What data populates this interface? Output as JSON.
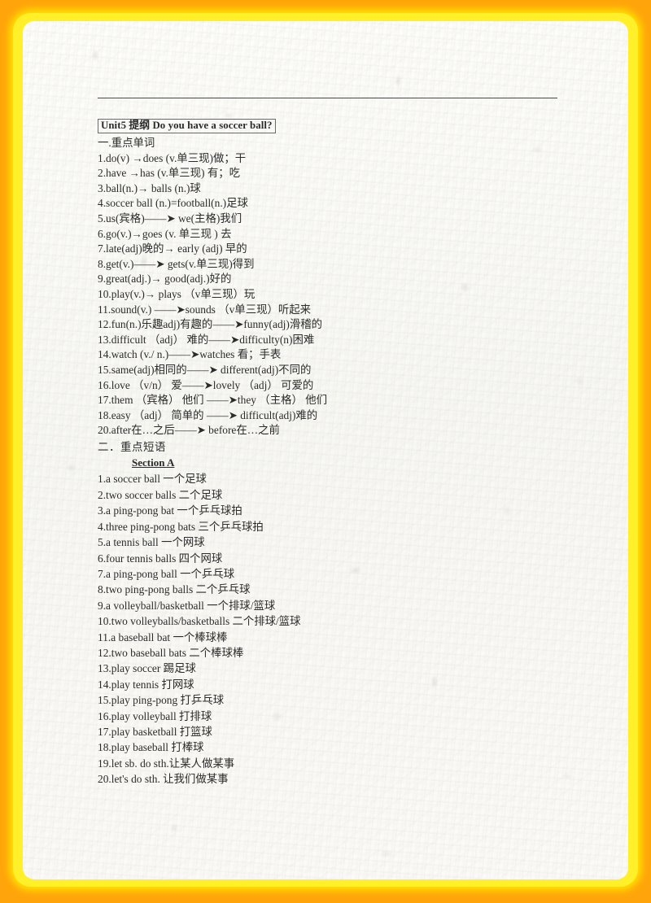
{
  "frame": {
    "outer_color": "#FFA40A",
    "glow_color": "#FFF02A",
    "paper_color": "#FAFAF7"
  },
  "document": {
    "title": "Unit5  提纲  Do you have a soccer ball?",
    "sections": [
      {
        "heading": "一.重点单词",
        "type": "vocabulary",
        "items": [
          "1.do(v)  →does (v.单三现)做；干",
          "2.have  →has (v.单三现)  有；吃",
          "3.ball(n.)→ balls (n.)球",
          "4.soccer ball (n.)=football(n.)足球",
          "5.us(宾格)——➤ we(主格)我们",
          "6.go(v.)→goes  (v. 单三现    ) 去",
          "7.late(adj)晚的→ early (adj) 早的",
          "8.get(v.)——➤ gets(v.单三现)得到",
          "9.great(adj.)→ good(adj.)好的",
          "10.play(v.)→ plays （v单三现）玩",
          "11.sound(v.) ——➤sounds （v单三现）听起来",
          "12.fun(n.)乐趣adj)有趣的——➤funny(adj)滑稽的",
          "13.difficult （adj） 难的——➤difficulty(n)困难",
          "14.watch (v./ n.)——➤watches  看；手表",
          "15.same(adj)相同的——➤ different(adj)不同的",
          "16.love （v/n） 爱——➤lovely （adj） 可爱的",
          "17.them （宾格） 他们 ——➤they （主格） 他们",
          "18.easy （adj） 简单的 ——➤ difficult(adj)难的",
          "20.after在…之后——➤ before在…之前"
        ]
      },
      {
        "heading": "二．重点短语",
        "subheading": "Section A",
        "type": "phrases",
        "items": [
          "1.a soccer ball  一个足球",
          "2.two soccer balls 二个足球",
          "3.a ping-pong bat 一个乒乓球拍",
          "4.three ping-pong bats 三个乒乓球拍",
          "5.a tennis ball 一个网球",
          "6.four tennis balls 四个网球",
          "7.a ping-pong ball 一个乒乓球",
          "8.two ping-pong balls 二个乒乓球",
          "9.a volleyball/basketball 一个排球/篮球",
          "10.two volleyballs/basketballs 二个排球/篮球",
          "11.a baseball bat 一个棒球棒",
          "12.two baseball bats 二个棒球棒",
          "13.play soccer 踢足球",
          "14.play tennis 打网球",
          "15.play ping-pong 打乒乓球",
          "16.play volleyball 打排球",
          "17.play basketball 打篮球",
          "18.play baseball 打棒球",
          "19.let sb. do sth.让某人做某事",
          "20.let's do sth.  让我们做某事"
        ]
      }
    ]
  }
}
